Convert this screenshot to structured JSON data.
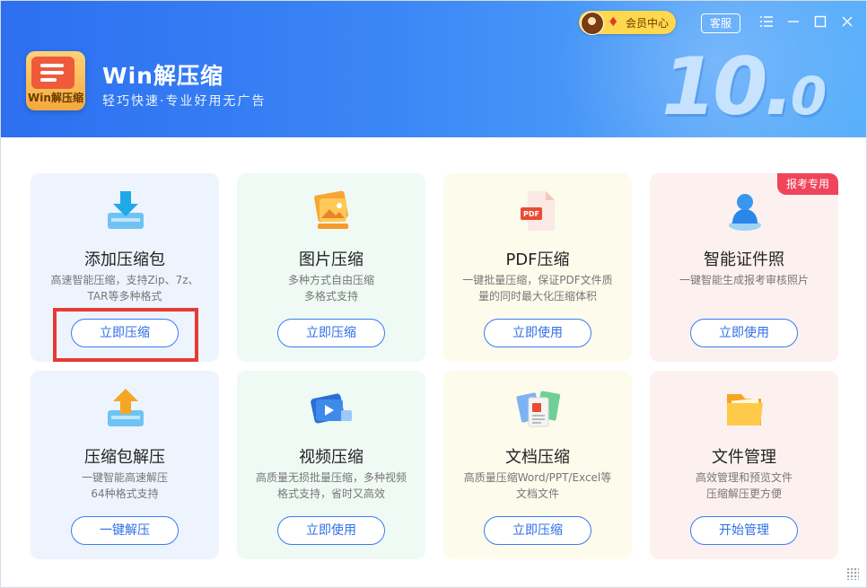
{
  "app": {
    "title": "Win解压缩",
    "subtitle": "轻巧快速·专业好用无广告",
    "logo_text": "Win解压缩",
    "version_major": "10.",
    "version_minor": "0"
  },
  "titlebar": {
    "vip_label": "会员中心",
    "service_label": "客服",
    "menu_icon": "menu-icon",
    "minimize_icon": "minimize-icon",
    "maximize_icon": "maximize-icon",
    "close_icon": "close-icon"
  },
  "colors": {
    "header_start": "#2d6ff0",
    "header_end": "#5bb0fb",
    "accent": "#2f6fe6",
    "badge": "#f0445a",
    "highlight": "#e53b35"
  },
  "cards": [
    {
      "title": "添加压缩包",
      "desc1": "高速智能压缩，支持Zip、7z、",
      "desc2": "TAR等多种格式",
      "button": "立即压缩",
      "icon": "archive-download-icon"
    },
    {
      "title": "图片压缩",
      "desc1": "多种方式自由压缩",
      "desc2": "多格式支持",
      "button": "立即压缩",
      "icon": "image-compress-icon"
    },
    {
      "title": "PDF压缩",
      "desc1": "一键批量压缩，保证PDF文件质",
      "desc2": "量的同时最大化压缩体积",
      "button": "立即使用",
      "icon": "pdf-icon"
    },
    {
      "title": "智能证件照",
      "desc1": "一键智能生成报考审核照片",
      "desc2": "",
      "button": "立即使用",
      "icon": "id-photo-icon",
      "badge": "报考专用"
    },
    {
      "title": "压缩包解压",
      "desc1": "一键智能高速解压",
      "desc2": "64种格式支持",
      "button": "一键解压",
      "icon": "archive-extract-icon"
    },
    {
      "title": "视频压缩",
      "desc1": "高质量无损批量压缩，多种视频",
      "desc2": "格式支持，省时又高效",
      "button": "立即使用",
      "icon": "video-compress-icon"
    },
    {
      "title": "文档压缩",
      "desc1": "高质量压缩Word/PPT/Excel等",
      "desc2": "文档文件",
      "button": "立即压缩",
      "icon": "document-compress-icon"
    },
    {
      "title": "文件管理",
      "desc1": "高效管理和预览文件",
      "desc2": "压缩解压更方便",
      "button": "开始管理",
      "icon": "folder-icon"
    }
  ]
}
